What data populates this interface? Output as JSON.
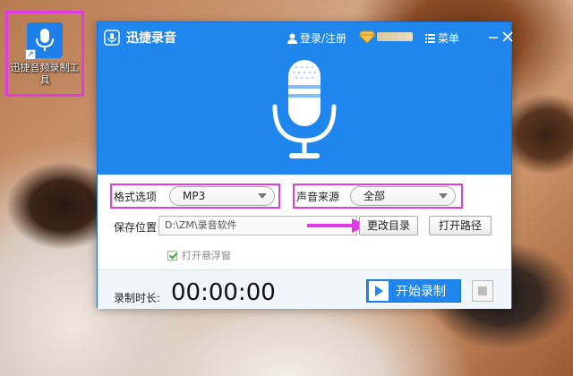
{
  "desktop": {
    "icon_label": "迅捷音频录制工具"
  },
  "app": {
    "title": "迅捷录音",
    "login_label": "登录/注册",
    "menu_label": "菜单"
  },
  "format": {
    "label": "格式选项",
    "selected": "MP3"
  },
  "source": {
    "label": "声音来源",
    "selected": "全部"
  },
  "save": {
    "label": "保存位置",
    "path": "D:\\ZM\\录音软件",
    "change_dir_label": "更改目录",
    "open_path_label": "打开路径"
  },
  "floating_window": {
    "label": "打开悬浮窗",
    "checked": true
  },
  "footer": {
    "time_label": "录制时长:",
    "time_value": "00:00:00",
    "start_label": "开始录制"
  },
  "colors": {
    "accent": "#1e86ec",
    "highlight": "#e13be8"
  }
}
